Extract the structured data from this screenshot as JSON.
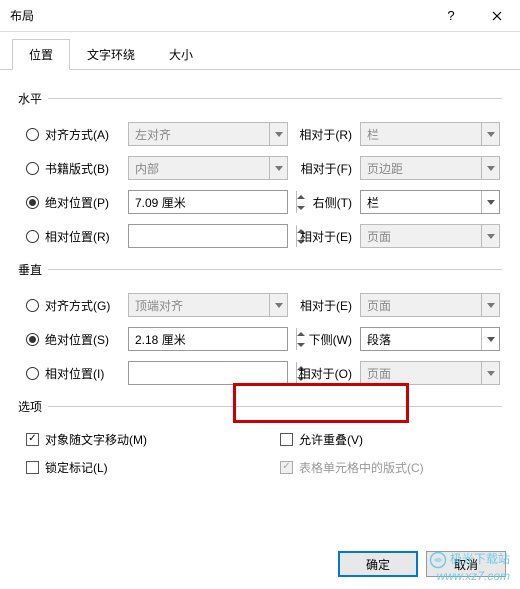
{
  "window": {
    "title": "布局"
  },
  "tabs": {
    "t0": "位置",
    "t1": "文字环绕",
    "t2": "大小"
  },
  "sections": {
    "horizontal": "水平",
    "vertical": "垂直",
    "options": "选项"
  },
  "horiz": {
    "r0": {
      "label": "对齐方式(A)",
      "combo": "左对齐",
      "rel_label": "相对于(R)",
      "rel_combo": "栏"
    },
    "r1": {
      "label": "书籍版式(B)",
      "combo": "内部",
      "rel_label": "相对于(F)",
      "rel_combo": "页边距"
    },
    "r2": {
      "label": "绝对位置(P)",
      "value": "7.09 厘米",
      "rel_label": "右侧(T)",
      "rel_combo": "栏"
    },
    "r3": {
      "label": "相对位置(R)",
      "value": "",
      "rel_label": "相对于(E)",
      "rel_combo": "页面"
    }
  },
  "vert": {
    "r0": {
      "label": "对齐方式(G)",
      "combo": "顶端对齐",
      "rel_label": "相对于(E)",
      "rel_combo": "页面"
    },
    "r1": {
      "label": "绝对位置(S)",
      "value": "2.18 厘米",
      "rel_label": "下侧(W)",
      "rel_combo": "段落"
    },
    "r2": {
      "label": "相对位置(I)",
      "value": "",
      "rel_label": "相对于(O)",
      "rel_combo": "页面"
    }
  },
  "options": {
    "o0": "对象随文字移动(M)",
    "o1": "允许重叠(V)",
    "o2": "锁定标记(L)",
    "o3": "表格单元格中的版式(C)"
  },
  "buttons": {
    "ok": "确定",
    "cancel": "取消"
  },
  "watermark": {
    "cn": "极光下载站",
    "url": "www.xz7.com"
  }
}
